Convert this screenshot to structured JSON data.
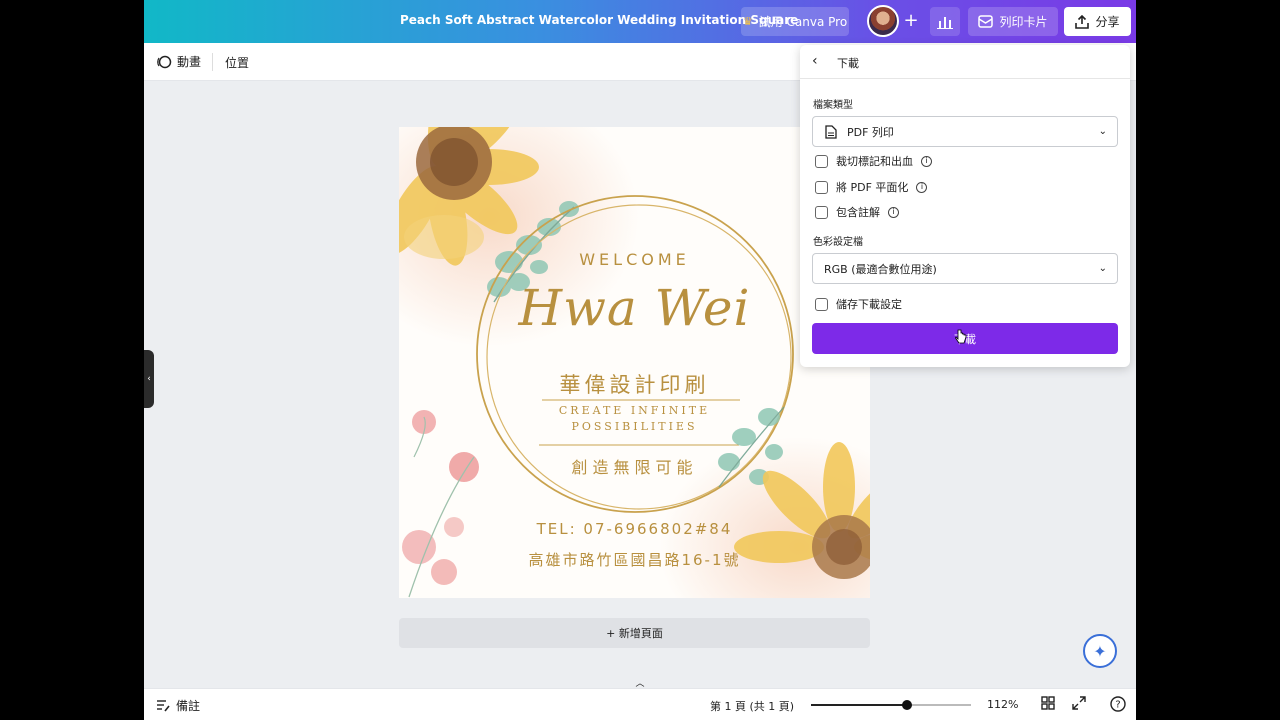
{
  "topbar": {
    "doc_title": "Peach Soft Abstract Watercolor Wedding Invitation Square",
    "try_pro_label": "試用 Canva Pro",
    "add_member": "+",
    "print_card_label": "列印卡片",
    "share_label": "分享"
  },
  "toolbar": {
    "animate_label": "動畫",
    "position_label": "位置"
  },
  "design": {
    "welcome": "WELCOME",
    "script_name": "Hwa Wei",
    "brand_cn": "華偉設計印刷",
    "slogan_line1": "CREATE INFINITE",
    "slogan_line2": "POSSIBILITIES",
    "slogan_cn": "創造無限可能",
    "tel": "TEL: 07-6966802#84",
    "address": "高雄市路竹區國昌路16-1號"
  },
  "canvas": {
    "add_page_label": "+ 新增頁面"
  },
  "download_panel": {
    "title": "下載",
    "file_type_label": "檔案類型",
    "file_type_value": "PDF 列印",
    "crop_marks_label": "裁切標記和出血",
    "flatten_label": "將 PDF 平面化",
    "include_notes_label": "包含註解",
    "color_profile_label": "色彩設定檔",
    "color_profile_value": "RGB (最適合數位用途)",
    "save_settings_label": "儲存下載設定",
    "download_button_label": "下載"
  },
  "bottombar": {
    "notes_label": "備註",
    "page_indicator": "第 1 頁 (共 1 頁)",
    "zoom_level": "112%",
    "zoom_fraction": 0.6
  },
  "colors": {
    "brand_purple": "#7d2ae8",
    "gold_text": "#b8903f"
  }
}
